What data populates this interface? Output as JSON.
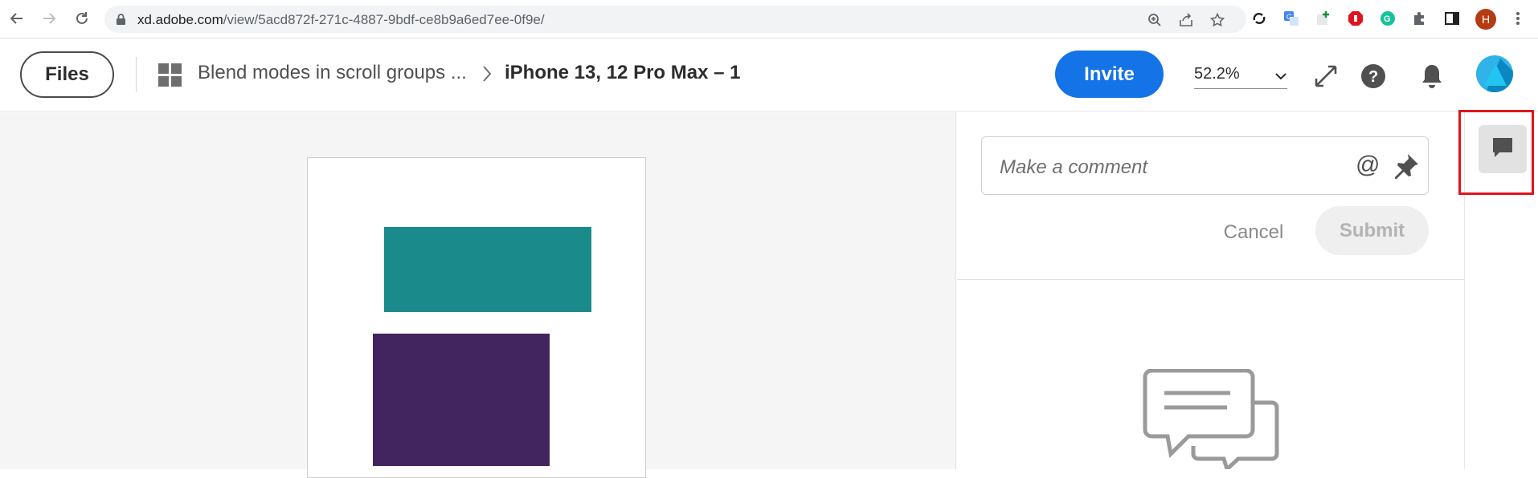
{
  "browser": {
    "url_host": "xd.adobe.com",
    "url_path": "/view/5acd872f-271c-4887-9bdf-ce8b9a6ed7ee-0f9e/",
    "profile_initial": "H"
  },
  "header": {
    "files_label": "Files",
    "document_name": "Blend modes in scroll groups ...",
    "artboard_name": "iPhone 13, 12 Pro Max – 1",
    "invite_label": "Invite",
    "zoom_value": "52.2%"
  },
  "canvas": {
    "shapes": [
      {
        "name": "teal-rectangle",
        "color": "#1b8a8a"
      },
      {
        "name": "purple-rectangle",
        "color": "#42245f"
      }
    ]
  },
  "comments": {
    "placeholder": "Make a comment",
    "mention_symbol": "@",
    "cancel_label": "Cancel",
    "submit_label": "Submit"
  },
  "colors": {
    "accent": "#1473e6",
    "highlight": "#e0141e"
  }
}
